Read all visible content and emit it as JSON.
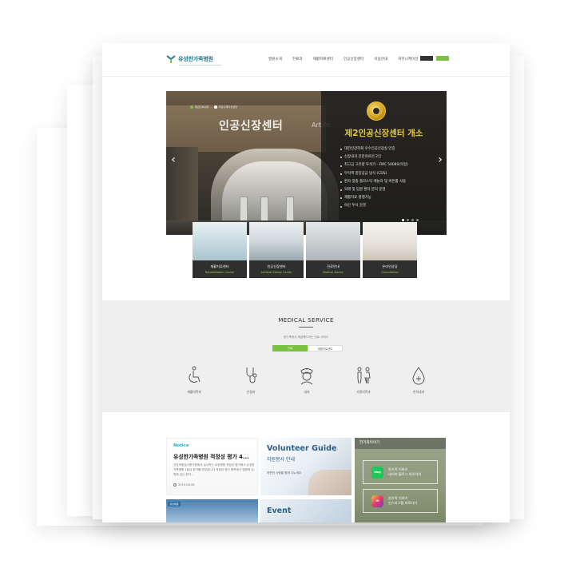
{
  "header": {
    "logo_text": "유성한가족병원",
    "nav": [
      "병원소개",
      "진료과",
      "재활치료센터",
      "인공신장센터",
      "이용안내",
      "커뮤니케이션"
    ],
    "util": [
      "",
      ""
    ]
  },
  "hero": {
    "sign": "인공신장센터",
    "sign_en": "Artific",
    "mini_tabs": [
      "응급진료상담",
      "커뮤니케이션상담"
    ],
    "overlay_title": "제2인공신장센터 개소",
    "list": [
      "대한신장학회 우수인공신장실 인증",
      "신장내과 전문의료진 2인",
      "최고급 고유량 투석기 - FMC 5008S(독일)",
      "무석액 중앙공급 방식 (CDS)",
      "환자 맞춤 플라스틱 캐뉼라 및 버튼홀 사용",
      "외래 및 입원 환자 분리 운영",
      "재활치료 병행가능",
      "야간 투석 운영"
    ],
    "prev_arrow": "‹",
    "next_arrow": "›"
  },
  "quick_cards": [
    {
      "ko": "재활치료센터",
      "en": "Rehabilitation Center"
    },
    {
      "ko": "인공신장센터",
      "en": "Artificial Kidney Center"
    },
    {
      "ko": "진료안내",
      "en": "Medical Advice"
    },
    {
      "ko": "온라인상담",
      "en": "Consultation"
    }
  ],
  "medical_service": {
    "title": "MEDICAL SERVICE",
    "subtitle": "한가족에서 제공해드리는 진료 서비스",
    "tabs": [
      "진료",
      "재활치료센터"
    ],
    "items": [
      {
        "label": "재활의학과",
        "icon": "wheelchair-icon"
      },
      {
        "label": "신경과",
        "icon": "stethoscope-icon"
      },
      {
        "label": "내과",
        "icon": "nurse-icon"
      },
      {
        "label": "가정의학과",
        "icon": "family-icon"
      },
      {
        "label": "한의내과",
        "icon": "drop-icon"
      }
    ]
  },
  "notice": {
    "label": "Notice",
    "title": "유성한가족병원 적정성 평가 4...",
    "body": "건강보험심사평가원에서 실시하는 요양병원 적정성 평가에서 유성한가족병원 1등급 평가를 받았습니다 적정성 평가 항목에서 병원에 입원해 있는 환자...",
    "date": "2019.08.08"
  },
  "volunteer": {
    "title": "Volunteer Guide",
    "subtitle": "자원봉사 안내",
    "small": "따뜻한 사랑을 함께 나누세요"
  },
  "family": {
    "header": "한가족이야기",
    "blog": {
      "badge": "blog",
      "line1": "한가족 이야기",
      "line2": "네이버 블로그 바로가기"
    },
    "insta": {
      "badge": "IG",
      "line1": "한가족 이야기",
      "line2": "인스타그램 바로가기"
    }
  },
  "row2": {
    "tag": "유성병원",
    "event": "Event"
  },
  "colors": {
    "accent_green": "#7cc242",
    "brand_teal": "#1d7a88",
    "overlay_gold": "#e5cc47"
  }
}
